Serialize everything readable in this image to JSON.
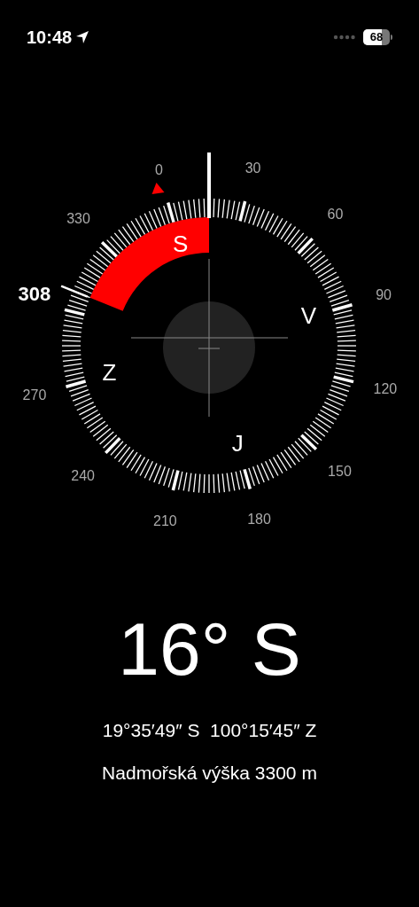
{
  "status_bar": {
    "time": "10:48",
    "battery": "68"
  },
  "compass": {
    "dial_labels": [
      "0",
      "30",
      "60",
      "90",
      "120",
      "150",
      "180",
      "210",
      "240",
      "270",
      "330"
    ],
    "cardinals": [
      "S",
      "V",
      "J",
      "Z"
    ],
    "bearing_marker": "308"
  },
  "heading": "16° S",
  "coordinates": "19°35′49″ S  100°15′45″ Z",
  "elevation": "Nadmořská výška 3300 m"
}
